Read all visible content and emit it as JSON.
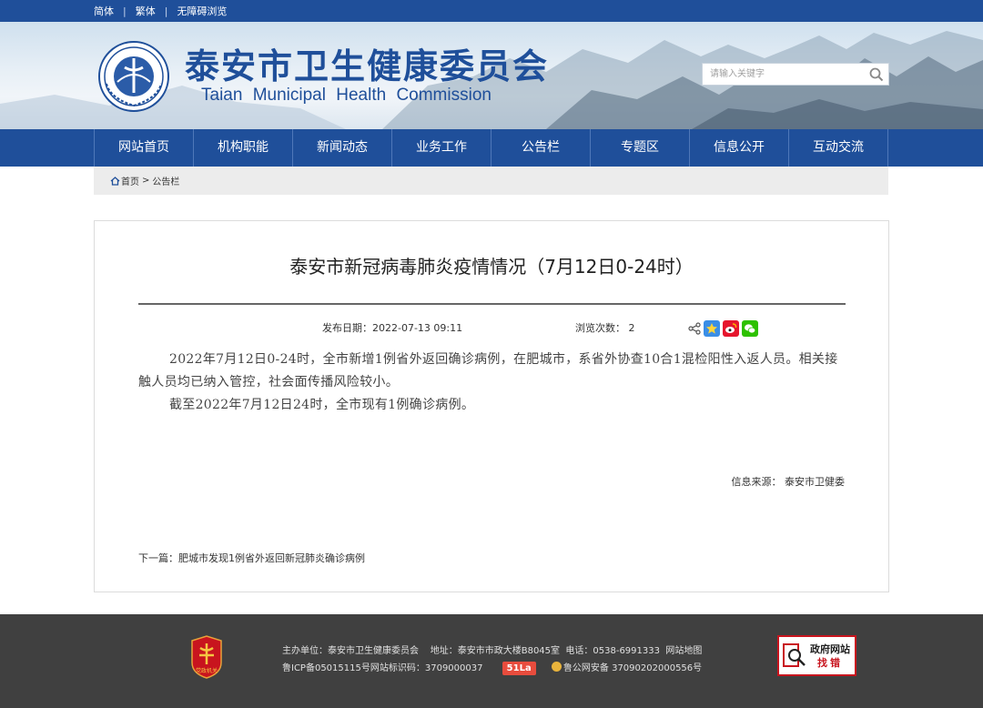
{
  "topbar": {
    "links": [
      "简体",
      "繁体",
      "无障碍浏览"
    ]
  },
  "header": {
    "title_cn": "泰安市卫生健康委员会",
    "title_en": "Taian  Municipal  Health  Commission",
    "search_placeholder": "请输入关键字"
  },
  "nav": {
    "items": [
      "网站首页",
      "机构职能",
      "新闻动态",
      "业务工作",
      "公告栏",
      "专题区",
      "信息公开",
      "互动交流"
    ]
  },
  "breadcrumb": {
    "home": "首页",
    "sep": ">",
    "current": "公告栏"
  },
  "article": {
    "title": "泰安市新冠病毒肺炎疫情情况（7月12日0-24时）",
    "publish_label": "发布日期：",
    "publish_date": "2022-07-13 09:11",
    "views_label": "浏览次数：",
    "views": "2",
    "paragraphs": [
      "2022年7月12日0-24时，全市新增1例省外返回确诊病例，在肥城市，系省外协查10合1混检阳性入返人员。相关接触人员均已纳入管控，社会面传播风险较小。",
      "截至2022年7月12日24时，全市现有1例确诊病例。"
    ],
    "source_label": "信息来源：",
    "source": "泰安市卫健委",
    "next_label": "下一篇：",
    "next_title": "肥城市发现1例省外返回新冠肺炎确诊病例"
  },
  "footer": {
    "sponsor": "主办单位：泰安市卫生健康委员会",
    "address": "地址：泰安市市政大楼B8045室",
    "phone": "电话：0538-6991333",
    "sitemap": "网站地图",
    "icp": "鲁ICP备05015115号网站标识码：3709000037",
    "stat_badge": "51La",
    "police": "鲁公网安备 37090202000556号",
    "gov_top": "政府网站",
    "gov_bottom": "找错",
    "emblem_text": "党政机关"
  },
  "colors": {
    "primary": "#1f4f9a",
    "footer": "#404040",
    "accent_red": "#c8141e"
  }
}
